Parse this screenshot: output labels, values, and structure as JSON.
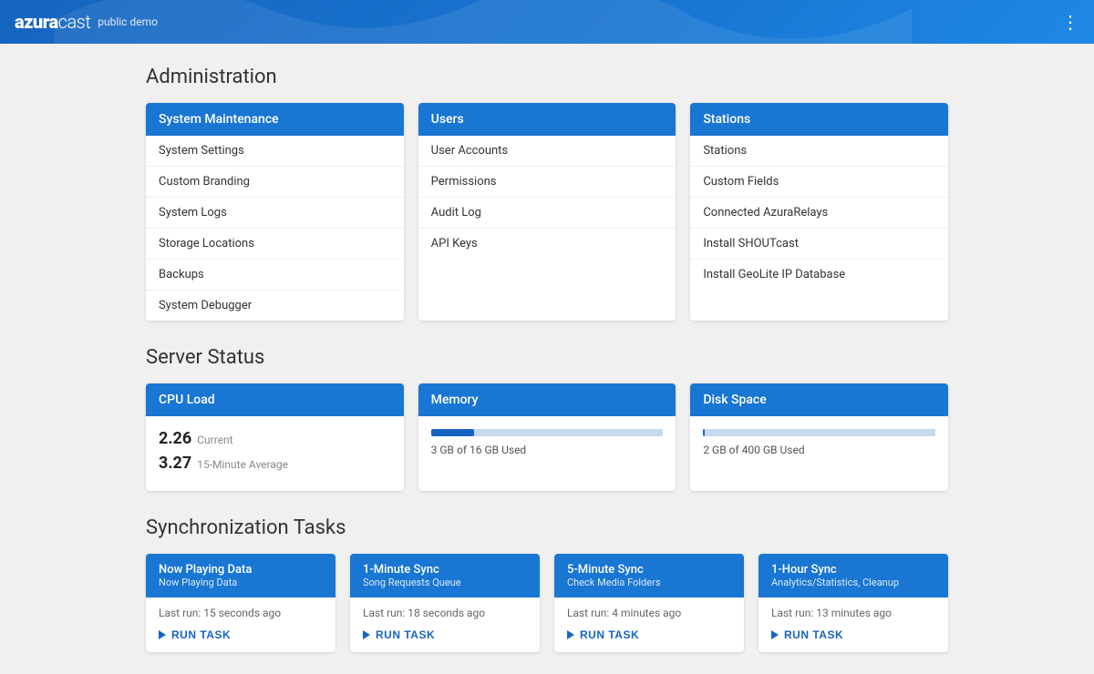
{
  "header": {
    "logo": "azuracast",
    "logo_span": "cast",
    "subtitle": "public demo",
    "menu_icon": "⋮"
  },
  "administration": {
    "section_title": "Administration",
    "system_maintenance": {
      "header": "System Maintenance",
      "links": [
        "System Settings",
        "Custom Branding",
        "System Logs",
        "Storage Locations",
        "Backups",
        "System Debugger"
      ]
    },
    "users": {
      "header": "Users",
      "links": [
        "User Accounts",
        "Permissions",
        "Audit Log",
        "API Keys"
      ]
    },
    "stations": {
      "header": "Stations",
      "links": [
        "Stations",
        "Custom Fields",
        "Connected AzuraRelays",
        "Install SHOUTcast",
        "Install GeoLite IP Database"
      ]
    }
  },
  "server_status": {
    "section_title": "Server Status",
    "cpu": {
      "header": "CPU Load",
      "current_value": "2.26",
      "current_label": "Current",
      "average_value": "3.27",
      "average_label": "15-Minute Average"
    },
    "memory": {
      "header": "Memory",
      "used_gb": 3,
      "total_gb": 16,
      "label": "3 GB of 16 GB Used",
      "percent": 18.75
    },
    "disk": {
      "header": "Disk Space",
      "used_gb": 2,
      "total_gb": 400,
      "label": "2 GB of 400 GB Used",
      "percent": 0.5
    }
  },
  "sync_tasks": {
    "section_title": "Synchronization Tasks",
    "tasks": [
      {
        "title": "Now Playing Data",
        "subtitle": "Now Playing Data",
        "last_run": "Last run: 15 seconds ago",
        "run_label": "RUN TASK"
      },
      {
        "title": "1-Minute Sync",
        "subtitle": "Song Requests Queue",
        "last_run": "Last run: 18 seconds ago",
        "run_label": "RUN TASK"
      },
      {
        "title": "5-Minute Sync",
        "subtitle": "Check Media Folders",
        "last_run": "Last run: 4 minutes ago",
        "run_label": "RUN TASK"
      },
      {
        "title": "1-Hour Sync",
        "subtitle": "Analytics/Statistics, Cleanup",
        "last_run": "Last run: 13 minutes ago",
        "run_label": "RUN TASK"
      }
    ]
  }
}
